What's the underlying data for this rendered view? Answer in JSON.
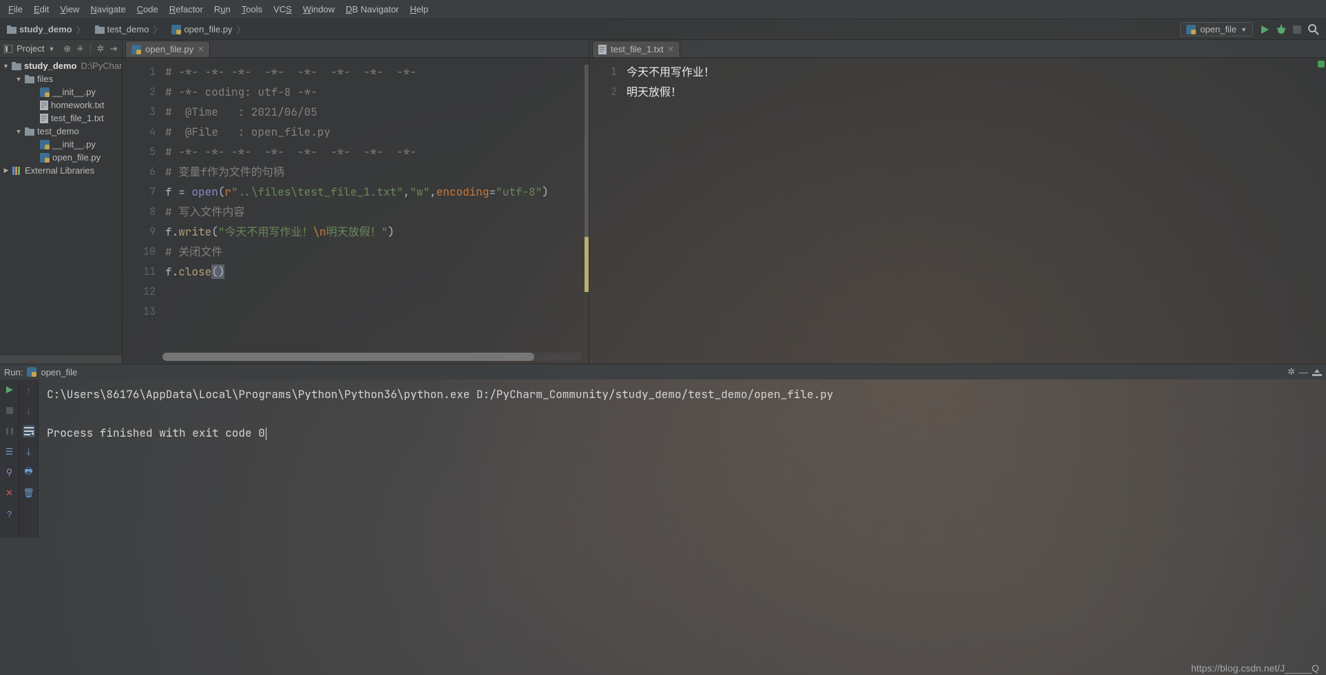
{
  "menu": [
    "File",
    "Edit",
    "View",
    "Navigate",
    "Code",
    "Refactor",
    "Run",
    "Tools",
    "VCS",
    "Window",
    "DB Navigator",
    "Help"
  ],
  "breadcrumbs": [
    {
      "icon": "folder",
      "label": "study_demo",
      "bold": true
    },
    {
      "icon": "folder",
      "label": "test_demo"
    },
    {
      "icon": "py",
      "label": "open_file.py"
    }
  ],
  "run_config": {
    "name": "open_file"
  },
  "project_panel": {
    "title": "Project",
    "tree": {
      "root": {
        "label": "study_demo",
        "hint": "D:\\PyChar"
      },
      "files_dir": "files",
      "files_children": [
        "__init__.py",
        "homework.txt",
        "test_file_1.txt"
      ],
      "test_demo_dir": "test_demo",
      "test_demo_children": [
        "__init__.py",
        "open_file.py"
      ],
      "ext_lib": "External Libraries"
    }
  },
  "editor_left": {
    "tab": "open_file.py",
    "lines": {
      "l1": "# -*- -*- -*-  -*-  -*-  -*-  -*-  -*-",
      "l2_a": "# -*- coding: utf-8 -*-",
      "l3": "#  @Time   : 2021/06/05",
      "l4": "#  @File   : open_file.py",
      "l5": "# -*- -*- -*-  -*-  -*-  -*-  -*-  -*-",
      "l6": "# 变量f作为文件的句柄",
      "l7_f": "f ",
      "l7_eq": "= ",
      "l7_open": "open",
      "l7_p1": "(",
      "l7_r": "r",
      "l7_s1": "\"..\\files\\test_file_1.txt\"",
      "l7_c1": ",",
      "l7_s2": "\"w\"",
      "l7_c2": ",",
      "l7_enc": "encoding",
      "l7_eq2": "=",
      "l7_s3": "\"utf-8\"",
      "l7_p2": ")",
      "l8": "# 写入文件内容",
      "l9_f": "f.",
      "l9_write": "write",
      "l9_p1": "(",
      "l9_s": "\"今天不用写作业！",
      "l9_esc": "\\n",
      "l9_s2": "明天放假！\"",
      "l9_p2": ")",
      "l10": "# 关闭文件",
      "l11_f": "f.",
      "l11_close": "close",
      "l11_p": "()"
    },
    "line_numbers": [
      "1",
      "2",
      "3",
      "4",
      "5",
      "6",
      "7",
      "8",
      "9",
      "10",
      "11",
      "12",
      "13"
    ]
  },
  "editor_right": {
    "tab": "test_file_1.txt",
    "line_numbers": [
      "1",
      "2"
    ],
    "lines": {
      "l1": "今天不用写作业！",
      "l2": "明天放假！"
    }
  },
  "run_window": {
    "title": "Run:",
    "config": "open_file",
    "cmd": "C:\\Users\\86176\\AppData\\Local\\Programs\\Python\\Python36\\python.exe D:/PyCharm_Community/study_demo/test_demo/open_file.py",
    "blank": "",
    "result": "Process finished with exit code 0"
  },
  "watermark": "https://blog.csdn.net/J_____Q"
}
